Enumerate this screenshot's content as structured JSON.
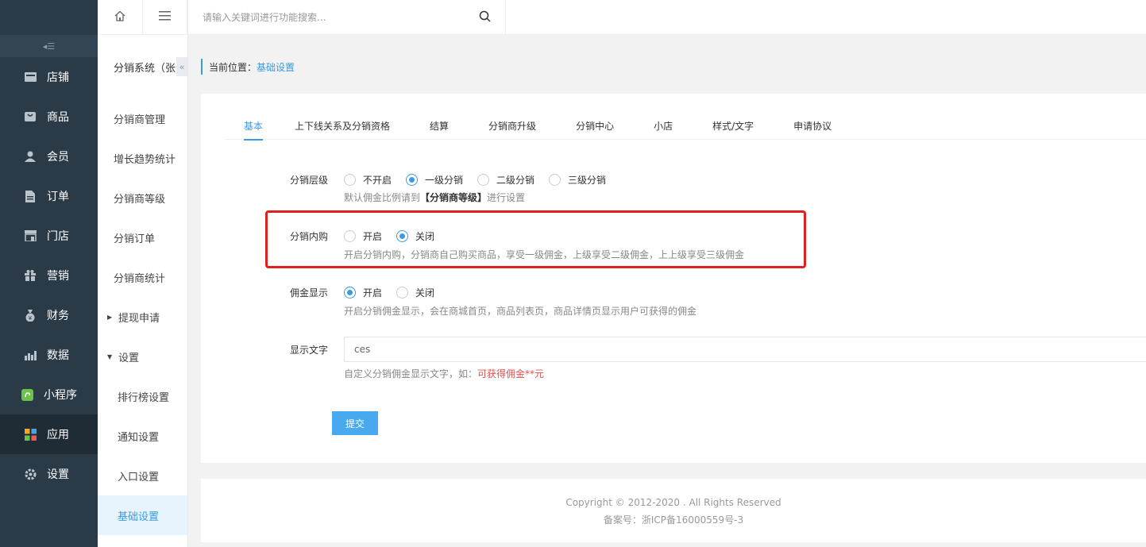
{
  "main_nav": {
    "items": [
      {
        "label": "店铺",
        "icon": "store-icon"
      },
      {
        "label": "商品",
        "icon": "goods-icon"
      },
      {
        "label": "会员",
        "icon": "member-icon"
      },
      {
        "label": "订单",
        "icon": "order-icon"
      },
      {
        "label": "门店",
        "icon": "shop-icon"
      },
      {
        "label": "营销",
        "icon": "gift-icon"
      },
      {
        "label": "财务",
        "icon": "money-bag-icon"
      },
      {
        "label": "数据",
        "icon": "chart-icon"
      },
      {
        "label": "小程序",
        "icon": "miniprogram-icon"
      },
      {
        "label": "应用",
        "icon": "apps-icon"
      },
      {
        "label": "设置",
        "icon": "gear-icon"
      }
    ],
    "active_index": 9
  },
  "sub_nav": {
    "title": "分销系统（张",
    "items": [
      {
        "label": "分销商管理"
      },
      {
        "label": "增长趋势统计"
      },
      {
        "label": "分销商等级"
      },
      {
        "label": "分销订单"
      },
      {
        "label": "分销商统计"
      }
    ],
    "groups": [
      {
        "label": "提现申请",
        "expanded": false
      },
      {
        "label": "设置",
        "expanded": true
      }
    ],
    "children": [
      {
        "label": "排行榜设置"
      },
      {
        "label": "通知设置"
      },
      {
        "label": "入口设置"
      },
      {
        "label": "基础设置"
      }
    ],
    "active_child": "基础设置"
  },
  "topbar": {
    "search_placeholder": "请输入关键词进行功能搜索..."
  },
  "breadcrumb": {
    "prefix": "当前位置：",
    "current": "基础设置"
  },
  "tabs": [
    {
      "label": "基本",
      "active": true
    },
    {
      "label": "上下线关系及分销资格"
    },
    {
      "label": "结算"
    },
    {
      "label": "分销商升级"
    },
    {
      "label": "分销中心"
    },
    {
      "label": "小店"
    },
    {
      "label": "样式/文字"
    },
    {
      "label": "申请协议"
    }
  ],
  "form": {
    "level": {
      "label": "分销层级",
      "options": [
        "不开启",
        "一级分销",
        "二级分销",
        "三级分销"
      ],
      "selected": "一级分销",
      "hint_prefix": "默认佣金比例请到",
      "hint_bold": "【分销商等级】",
      "hint_suffix": "进行设置"
    },
    "self_buy": {
      "label": "分销内购",
      "options": [
        "开启",
        "关闭"
      ],
      "selected": "关闭",
      "hint": "开启分销内购，分销商自己购买商品，享受一级佣金，上级享受二级佣金，上上级享受三级佣金"
    },
    "commission_display": {
      "label": "佣金显示",
      "options": [
        "开启",
        "关闭"
      ],
      "selected": "开启",
      "hint": "开启分销佣金显示，会在商城首页，商品列表页，商品详情页显示用户可获得的佣金"
    },
    "display_text": {
      "label": "显示文字",
      "value": "ces",
      "hint_prefix": "自定义分销佣金显示文字，如：",
      "hint_red": "可获得佣金**元"
    },
    "submit_label": "提交"
  },
  "footer": {
    "copyright": "Copyright © 2012-2020 . All Rights Reserved",
    "icp": "备案号：浙ICP备16000559号-3"
  },
  "colors": {
    "accent": "#3a9ce0",
    "sidebar_bg": "#2b3a47",
    "highlight": "#e02020",
    "hint_red": "#e05050"
  }
}
